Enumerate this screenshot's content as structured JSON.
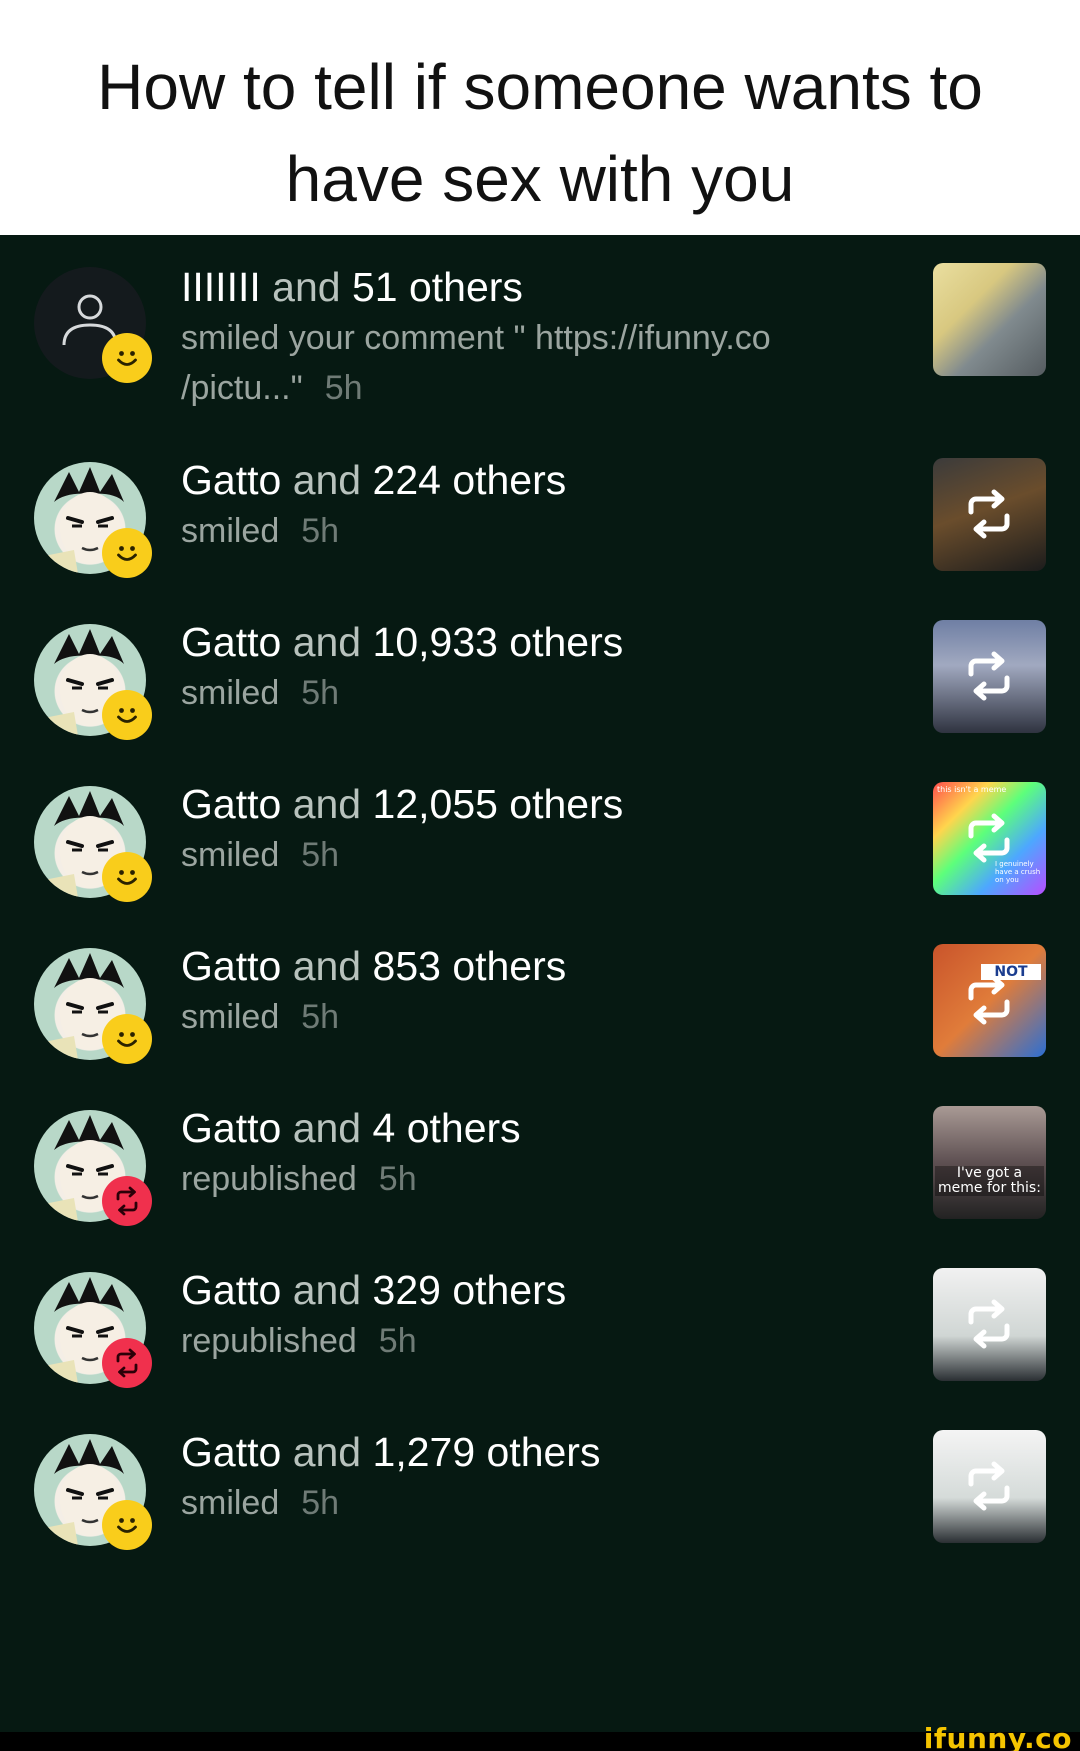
{
  "caption": "How to tell if someone wants to have sex with you",
  "colors": {
    "background": "#061912",
    "smile_badge": "#f9cd1b",
    "republish_badge": "#f0304d",
    "watermark": "#f5c400"
  },
  "notifications": [
    {
      "user": "IIIIIII",
      "and_text": "and",
      "others": "51 others",
      "action": "smiled your comment \" https://ifunny.co /pictu...\"",
      "time": "5h",
      "badge_icon": "smile-icon",
      "thumb_overlay": false
    },
    {
      "user": "Gatto",
      "and_text": "and",
      "others": "224 others",
      "action": "smiled",
      "time": "5h",
      "badge_icon": "smile-icon",
      "thumb_overlay": true
    },
    {
      "user": "Gatto",
      "and_text": "and",
      "others": "10,933 others",
      "action": "smiled",
      "time": "5h",
      "badge_icon": "smile-icon",
      "thumb_overlay": true
    },
    {
      "user": "Gatto",
      "and_text": "and",
      "others": "12,055 others",
      "action": "smiled",
      "time": "5h",
      "badge_icon": "smile-icon",
      "thumb_overlay": true
    },
    {
      "user": "Gatto",
      "and_text": "and",
      "others": "853 others",
      "action": "smiled",
      "time": "5h",
      "badge_icon": "smile-icon",
      "thumb_overlay": true
    },
    {
      "user": "Gatto",
      "and_text": "and",
      "others": "4 others",
      "action": "republished",
      "time": "5h",
      "badge_icon": "repost-icon",
      "thumb_overlay": false
    },
    {
      "user": "Gatto",
      "and_text": "and",
      "others": "329 others",
      "action": "republished",
      "time": "5h",
      "badge_icon": "repost-icon",
      "thumb_overlay": true
    },
    {
      "user": "Gatto",
      "and_text": "and",
      "others": "1,279 others",
      "action": "smiled",
      "time": "5h",
      "badge_icon": "smile-icon",
      "thumb_overlay": true
    }
  ],
  "thumbnail_text": {
    "t4_top": "this isn't a meme",
    "t4_bottom": "I genuinely have a crush on you",
    "t5": "NOT",
    "t6": "I've got a meme for this:"
  },
  "watermark": "ifunny.co"
}
